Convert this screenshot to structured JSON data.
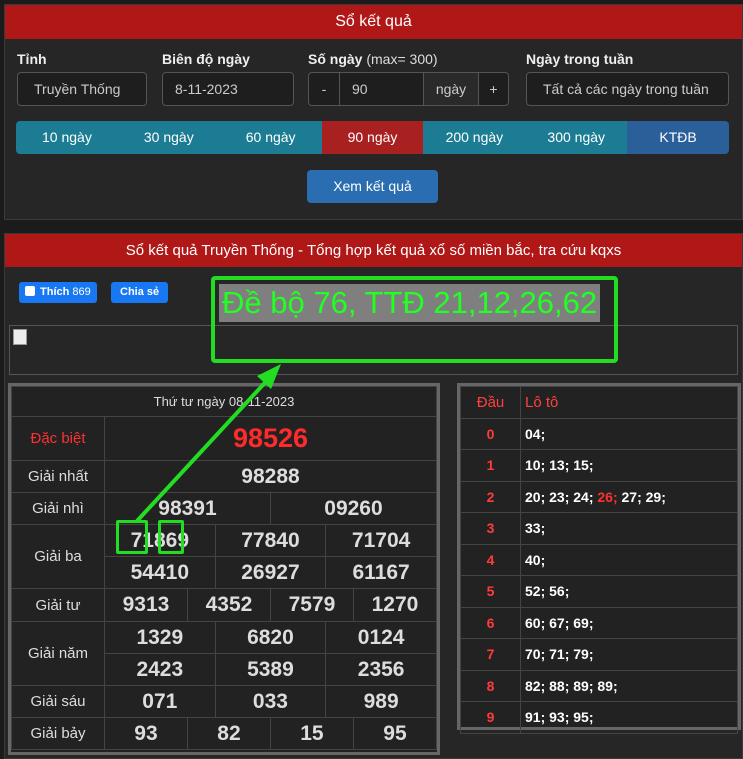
{
  "search": {
    "title": "Sổ kết quả",
    "tinh_label": "Tỉnh",
    "tinh_value": "Truyền Thống",
    "bien_do_label": "Biên độ ngày",
    "bien_do_value": "8-11-2023",
    "so_ngay_label": "Số ngày",
    "so_ngay_hint": "(max= 300)",
    "so_ngay_minus": "-",
    "so_ngay_value": "90",
    "so_ngay_unit": "ngày",
    "so_ngay_plus": "+",
    "weekday_label": "Ngày trong tuần",
    "weekday_value": "Tất cả các ngày trong tuần",
    "ranges": [
      "10 ngày",
      "30 ngày",
      "60 ngày",
      "90 ngày",
      "200 ngày",
      "300 ngày",
      "KTĐB"
    ],
    "active_range": "90 ngày",
    "submit_label": "Xem kết quả"
  },
  "result": {
    "title": "Sổ kết quả Truyền Thống - Tổng hợp kết quả xổ số miền bắc, tra cứu kqxs",
    "fb_like": "Thích",
    "fb_like_count": "869",
    "fb_share": "Chia sẻ",
    "overlay_text": "Đề bộ 76, TTĐ 21,12,26,62",
    "date": "Thứ tư ngày 08-11-2023",
    "prizes": {
      "dac_biet": {
        "label": "Đặc biệt",
        "numbers": [
          "98526"
        ]
      },
      "nhat": {
        "label": "Giải nhất",
        "numbers": [
          "98288"
        ]
      },
      "nhi": {
        "label": "Giải nhì",
        "numbers": [
          "98391",
          "09260"
        ]
      },
      "ba": {
        "label": "Giải ba",
        "numbers": [
          "71869",
          "77840",
          "71704",
          "54410",
          "26927",
          "61167"
        ]
      },
      "tu": {
        "label": "Giải tư",
        "numbers": [
          "9313",
          "4352",
          "7579",
          "1270"
        ]
      },
      "nam": {
        "label": "Giải năm",
        "numbers": [
          "1329",
          "6820",
          "0124",
          "2423",
          "5389",
          "2356"
        ]
      },
      "sau": {
        "label": "Giải sáu",
        "numbers": [
          "071",
          "033",
          "989"
        ]
      },
      "bay": {
        "label": "Giải bảy",
        "numbers": [
          "93",
          "82",
          "15",
          "95"
        ]
      }
    },
    "loto": {
      "head_label": "Đầu",
      "loto_label": "Lô tô",
      "rows": [
        {
          "dau": "0",
          "values": "04;"
        },
        {
          "dau": "1",
          "values": "10; 13; 15;"
        },
        {
          "dau": "2",
          "values_before": "20; 23; 24; ",
          "values_highlight": "26;",
          "values_after": " 27; 29;"
        },
        {
          "dau": "3",
          "values": "33;"
        },
        {
          "dau": "4",
          "values": "40;"
        },
        {
          "dau": "5",
          "values": "52; 56;"
        },
        {
          "dau": "6",
          "values": "60; 67; 69;"
        },
        {
          "dau": "7",
          "values": "70; 71; 79;"
        },
        {
          "dau": "8",
          "values": "82; 88; 89; 89;"
        },
        {
          "dau": "9",
          "values": "91; 93; 95;"
        }
      ]
    }
  },
  "colors": {
    "accent_red": "#b01818",
    "range_teal": "#1c7c93",
    "highlight_green": "#22dd22"
  }
}
